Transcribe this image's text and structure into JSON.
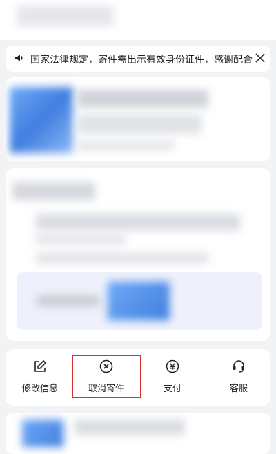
{
  "notice": {
    "text": "国家法律规定，寄件需出示有效身份证件，感谢配合",
    "speaker_icon": "speaker-icon",
    "close_icon": "close-icon"
  },
  "actions": [
    {
      "label": "修改信息",
      "icon": "edit-icon"
    },
    {
      "label": "取消寄件",
      "icon": "cancel-circle-icon"
    },
    {
      "label": "支付",
      "icon": "yen-icon"
    },
    {
      "label": "客服",
      "icon": "headset-icon"
    }
  ],
  "colors": {
    "highlight": "#d9302f",
    "accent_blue": "#4a8df0",
    "background": "#f2f3f5"
  }
}
